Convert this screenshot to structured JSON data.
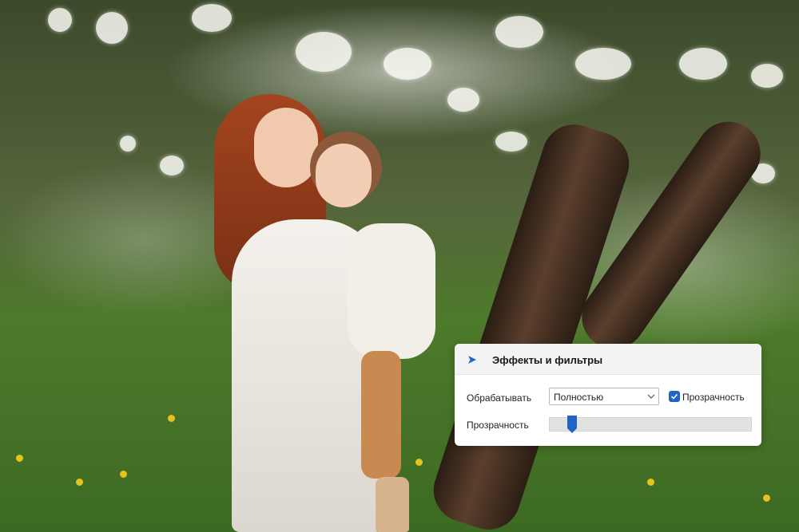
{
  "panel": {
    "title": "Эффекты и фильтры",
    "header_icon": "arrow-right-icon",
    "process_label": "Обрабатывать",
    "process_value": "Полностью",
    "transparency_checkbox_label": "Прозрачность",
    "transparency_checked": true,
    "transparency_label": "Прозрачность",
    "transparency_level": 0.09
  },
  "colors": {
    "accent": "#1f66c4",
    "panel_bg": "#ffffff",
    "header_bg": "#f3f3f3",
    "track": "#e2e2e2"
  }
}
